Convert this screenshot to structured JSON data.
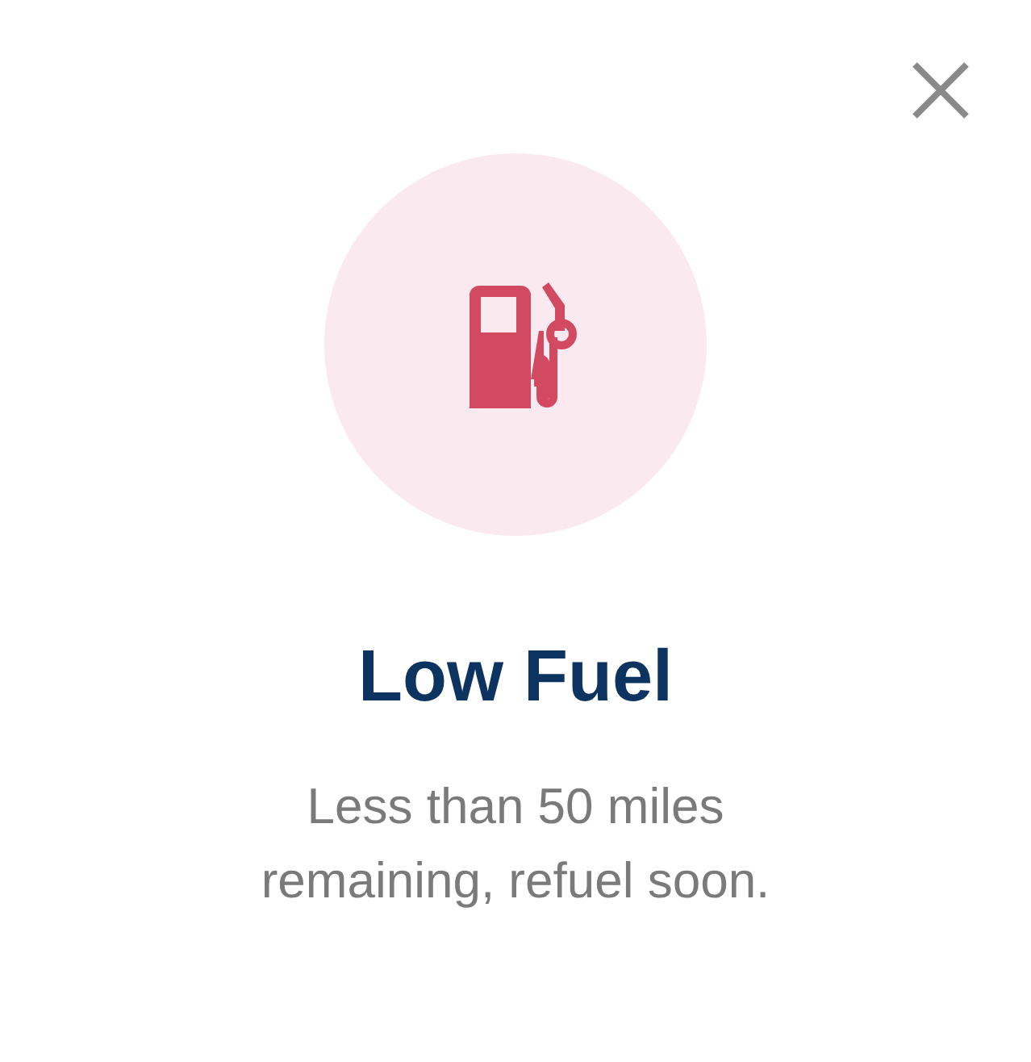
{
  "title": "Low Fuel",
  "message": "Less than 50 miles remaining, refuel soon."
}
